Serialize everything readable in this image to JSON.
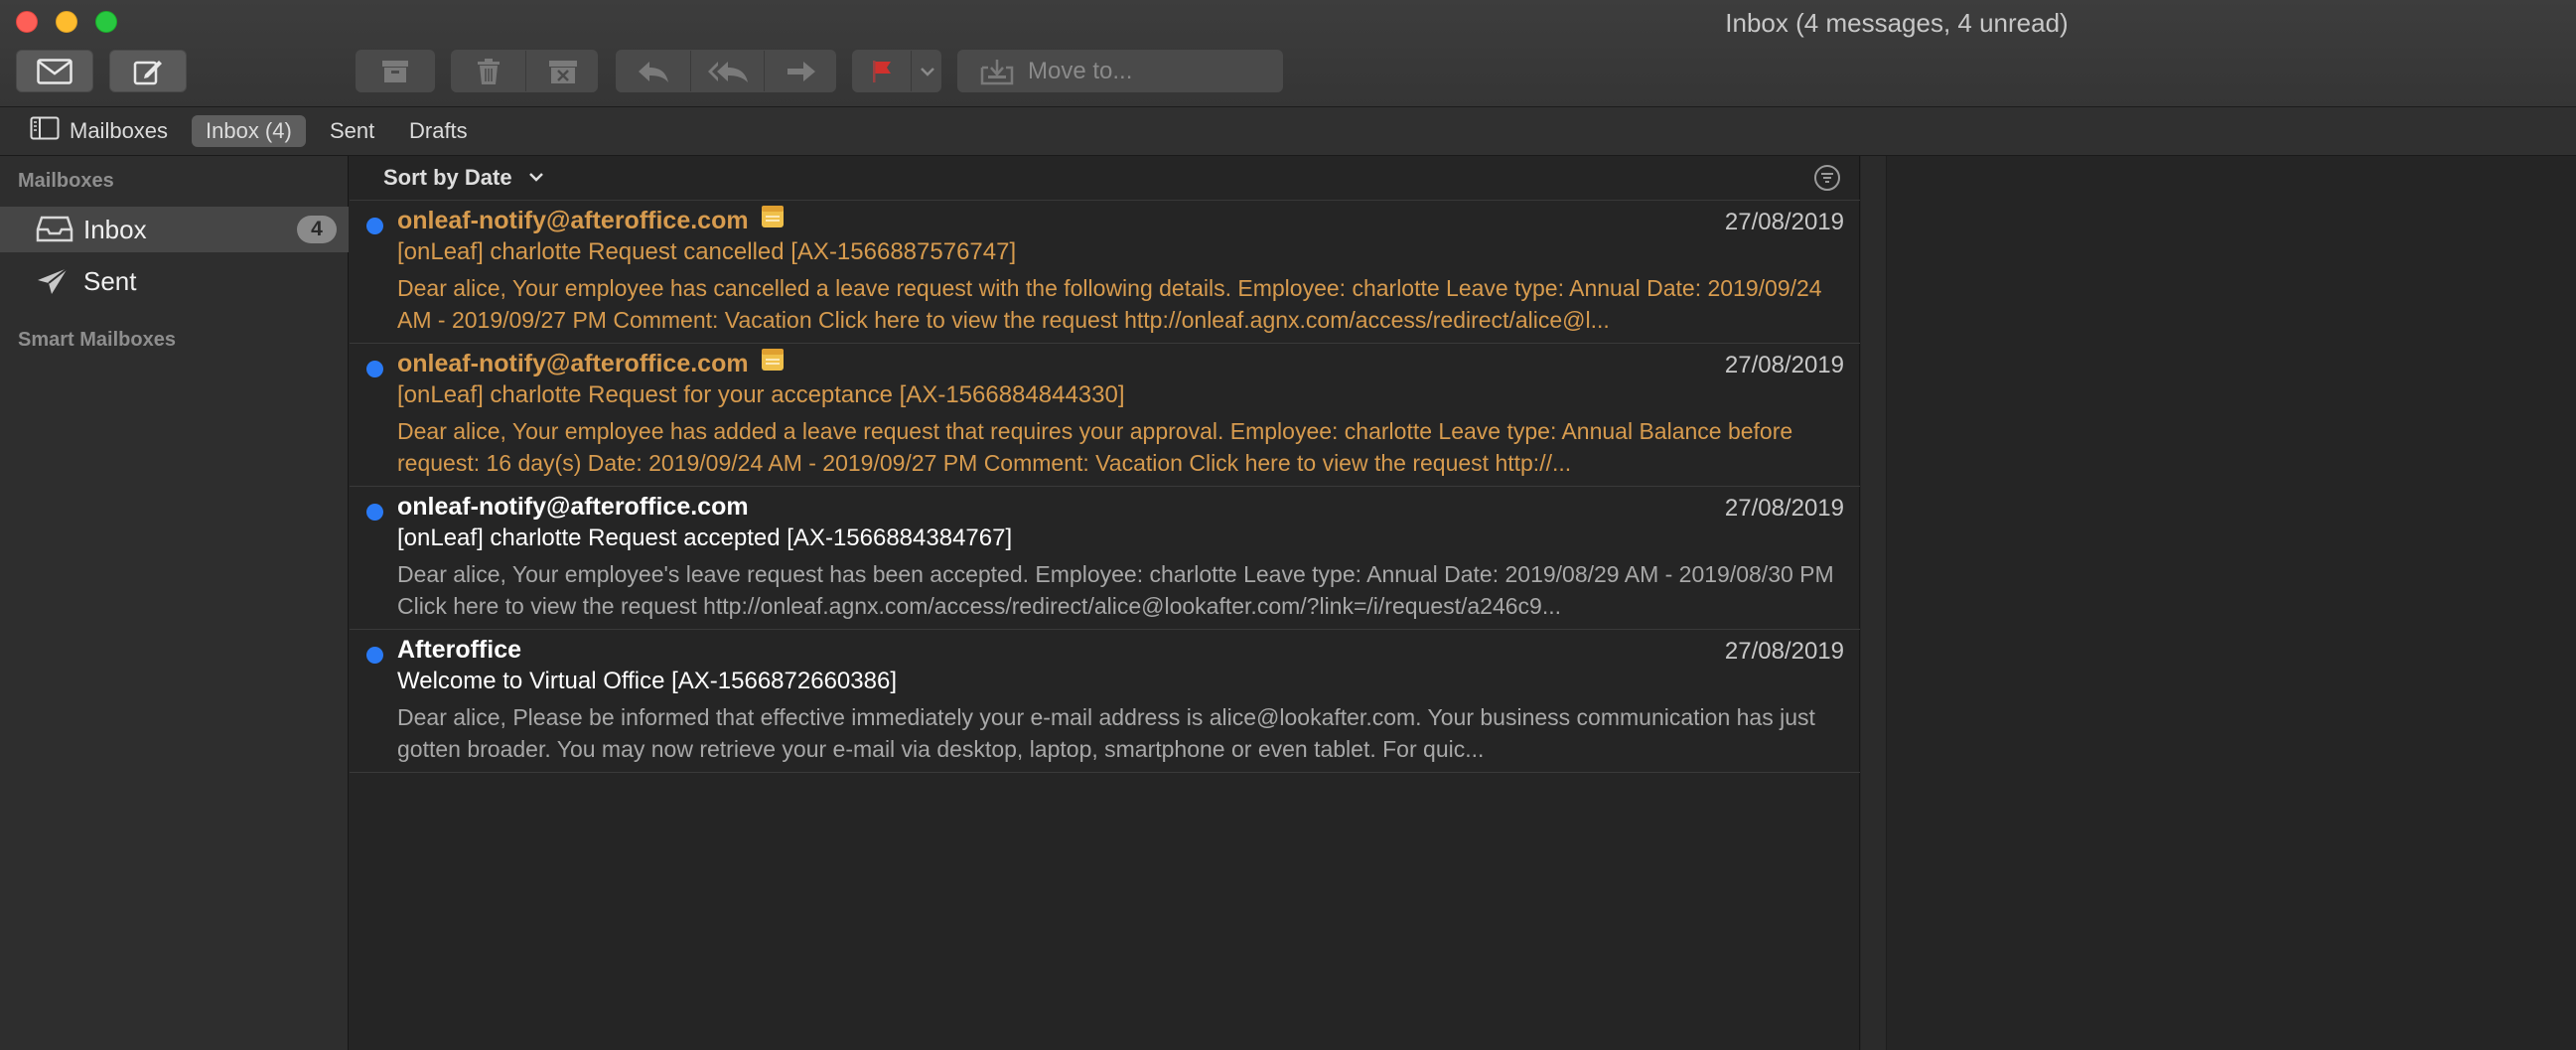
{
  "window": {
    "title": "Inbox (4 messages, 4 unread)"
  },
  "toolbar": {
    "get_mail_icon": "envelope-icon",
    "compose_icon": "compose-icon",
    "archive_icon": "archive-icon",
    "delete_icon": "trash-icon",
    "junk_icon": "junk-icon",
    "reply_icon": "reply-icon",
    "reply_all_icon": "reply-all-icon",
    "forward_icon": "forward-icon",
    "flag_icon": "flag-icon",
    "move_to_label": "Move to..."
  },
  "favorites": {
    "mailboxes_label": "Mailboxes",
    "inbox_label": "Inbox (4)",
    "sent_label": "Sent",
    "drafts_label": "Drafts"
  },
  "sidebar": {
    "mailboxes_header": "Mailboxes",
    "items": [
      {
        "label": "Inbox",
        "badge": "4",
        "icon": "inbox-tray-icon"
      },
      {
        "label": "Sent",
        "icon": "paper-plane-icon"
      }
    ],
    "smart_mailboxes_header": "Smart Mailboxes"
  },
  "list": {
    "sort_label": "Sort by Date",
    "messages": [
      {
        "sender": "onleaf-notify@afteroffice.com",
        "date": "27/08/2019",
        "subject": "[onLeaf] charlotte Request cancelled [AX-1566887576747]",
        "preview": "Dear alice, Your employee has cancelled a leave request with the following details. Employee: charlotte Leave type: Annual Date: 2019/09/24 AM - 2019/09/27 PM Comment: Vacation Click here to view the request http://onleaf.agnx.com/access/redirect/alice@l...",
        "flagged": true
      },
      {
        "sender": "onleaf-notify@afteroffice.com",
        "date": "27/08/2019",
        "subject": "[onLeaf] charlotte Request for your acceptance [AX-1566884844330]",
        "preview": "Dear alice, Your employee has added a leave request that requires your approval. Employee: charlotte Leave type: Annual Balance before request: 16 day(s) Date: 2019/09/24 AM - 2019/09/27 PM Comment: Vacation Click here to view the request http://...",
        "flagged": true
      },
      {
        "sender": "onleaf-notify@afteroffice.com",
        "date": "27/08/2019",
        "subject": "[onLeaf] charlotte Request accepted [AX-1566884384767]",
        "preview": "Dear alice, Your employee's leave request has been accepted. Employee: charlotte Leave type: Annual Date: 2019/08/29 AM - 2019/08/30 PM Click here to view the request http://onleaf.agnx.com/access/redirect/alice@lookafter.com/?link=/i/request/a246c9...",
        "flagged": false
      },
      {
        "sender": "Afteroffice",
        "date": "27/08/2019",
        "subject": "Welcome to Virtual Office [AX-1566872660386]",
        "preview": "Dear alice, Please be informed that effective immediately your e-mail address is alice@lookafter.com. Your business communication has just gotten broader. You may now retrieve your e-mail via desktop, laptop, smartphone or even tablet. For quic...",
        "flagged": false
      }
    ]
  },
  "colors": {
    "unread_dot": "#2a7af5",
    "flagged_text": "#d79b4e",
    "flag_red": "#d0312d"
  }
}
